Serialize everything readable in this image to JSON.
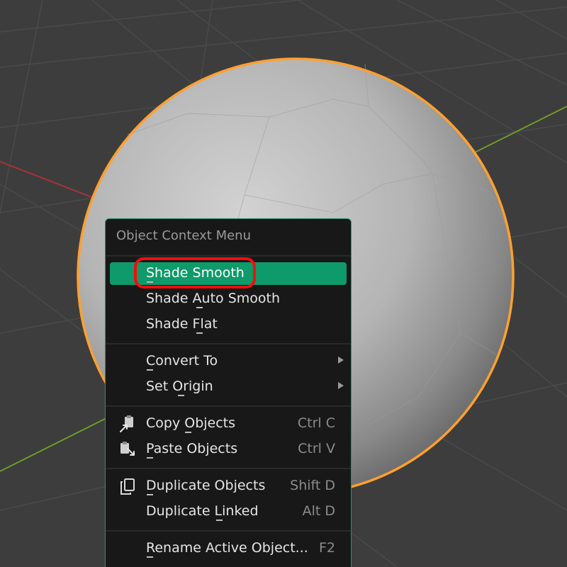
{
  "menu": {
    "title": "Object Context Menu",
    "groups": [
      {
        "items": [
          {
            "label": "Shade Smooth",
            "shortcut": "",
            "submenu": false,
            "active": true,
            "icon": ""
          },
          {
            "label": "Shade Auto Smooth",
            "shortcut": "",
            "submenu": false,
            "active": false,
            "icon": ""
          },
          {
            "label": "Shade Flat",
            "shortcut": "",
            "submenu": false,
            "active": false,
            "icon": ""
          }
        ]
      },
      {
        "items": [
          {
            "label": "Convert To",
            "shortcut": "",
            "submenu": true,
            "active": false,
            "icon": ""
          },
          {
            "label": "Set Origin",
            "shortcut": "",
            "submenu": true,
            "active": false,
            "icon": ""
          }
        ]
      },
      {
        "items": [
          {
            "label": "Copy Objects",
            "shortcut": "Ctrl C",
            "submenu": false,
            "active": false,
            "icon": "copy-clipboard-icon"
          },
          {
            "label": "Paste Objects",
            "shortcut": "Ctrl V",
            "submenu": false,
            "active": false,
            "icon": "paste-clipboard-icon"
          }
        ]
      },
      {
        "items": [
          {
            "label": "Duplicate Objects",
            "shortcut": "Shift D",
            "submenu": false,
            "active": false,
            "icon": "duplicate-icon"
          },
          {
            "label": "Duplicate Linked",
            "shortcut": "Alt D",
            "submenu": false,
            "active": false,
            "icon": ""
          }
        ]
      },
      {
        "items": [
          {
            "label": "Rename Active Object...",
            "shortcut": "F2",
            "submenu": false,
            "active": false,
            "icon": ""
          }
        ]
      }
    ]
  },
  "colors": {
    "viewport_bg": "#3d3d3d",
    "grid_line": "#4a4a4a",
    "x_axis": "#a8323a",
    "y_axis": "#6e9a2a",
    "selection_outline": "#ffa030",
    "menu_bg": "#181818",
    "menu_border": "#2f8f6a",
    "active_item": "#0e9a6a",
    "highlight_ring": "#ff0a0a"
  }
}
